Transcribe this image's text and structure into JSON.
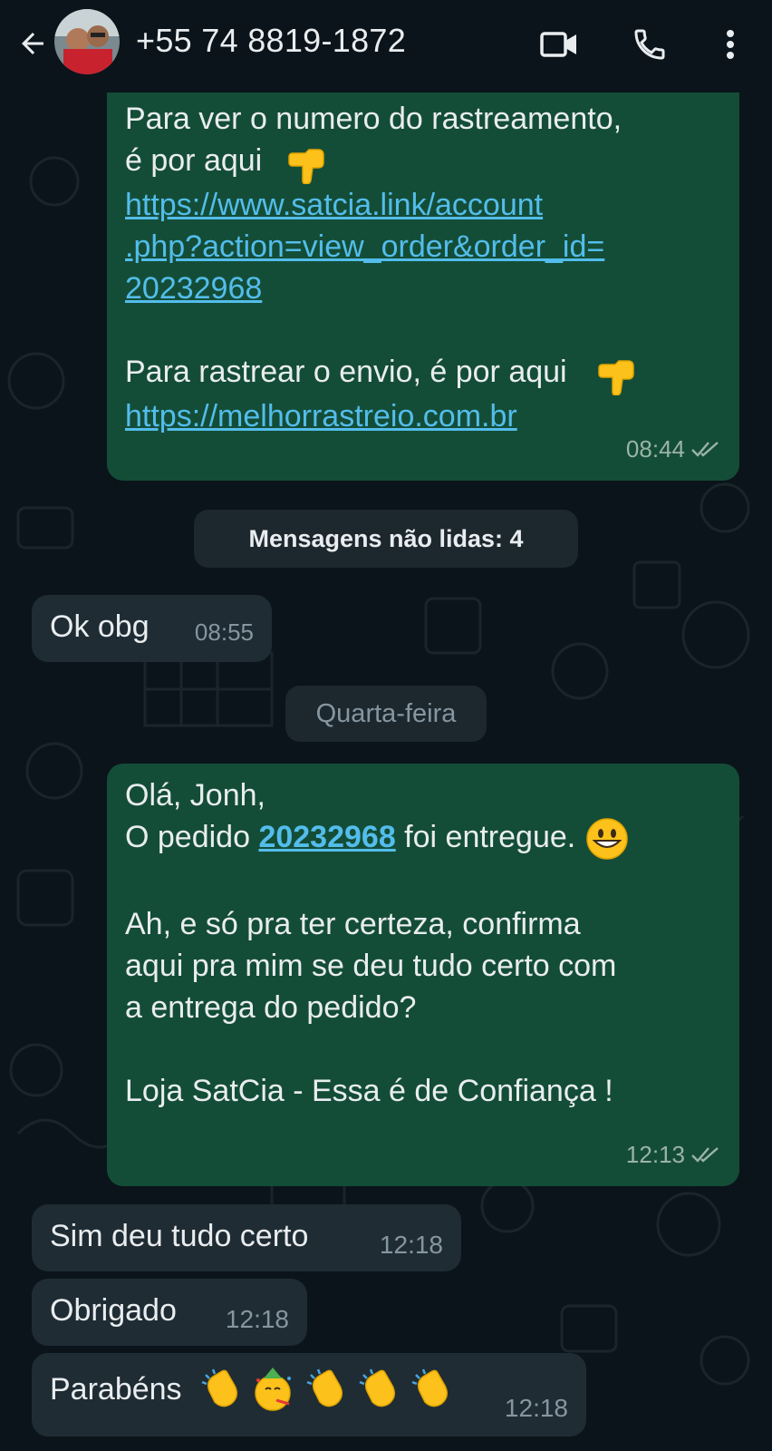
{
  "header": {
    "contact_name": "+55 74 8819-1872",
    "back_icon": "arrow-left-icon",
    "video_icon": "video-camera-icon",
    "call_icon": "phone-icon",
    "menu_icon": "more-vertical-icon"
  },
  "colors": {
    "background": "#0b141a",
    "outgoing_bubble": "#144d37",
    "incoming_bubble": "#1f2c34",
    "link": "#53bdeb",
    "read_tick": "#9bb3a8"
  },
  "messages": [
    {
      "direction": "out",
      "line1": "Para ver o numero do rastreamento,",
      "line2": "é por aqui",
      "link1_a": "https://www.satcia.link/account",
      "link1_b": ".php?action=view_order&order_id=",
      "link1_c": "20232968",
      "line3": "Para rastrear o envio, é por aqui",
      "link2": "https://melhorrastreio.com.br",
      "time": "08:44",
      "status": "read"
    },
    {
      "direction": "in",
      "text": "Ok obg",
      "time": "08:55"
    },
    {
      "direction": "out",
      "line1": "Olá, Jonh,",
      "line2_pre": "O pedido ",
      "line2_link": "20232968",
      "line2_post": " foi entregue.",
      "line3": "Ah, e só pra ter certeza, confirma",
      "line4": "aqui pra mim se deu tudo certo com",
      "line5": "a entrega do pedido?",
      "line6": "Loja SatCia - Essa é de Confiança !",
      "time": "12:13",
      "status": "read"
    },
    {
      "direction": "in",
      "text": "Sim deu tudo certo",
      "time": "12:18"
    },
    {
      "direction": "in",
      "text": "Obrigado",
      "time": "12:18"
    },
    {
      "direction": "in",
      "text": "Parabéns",
      "time": "12:18"
    }
  ],
  "unread_divider": "Mensagens não lidas: 4",
  "date_divider": "Quarta-feira"
}
